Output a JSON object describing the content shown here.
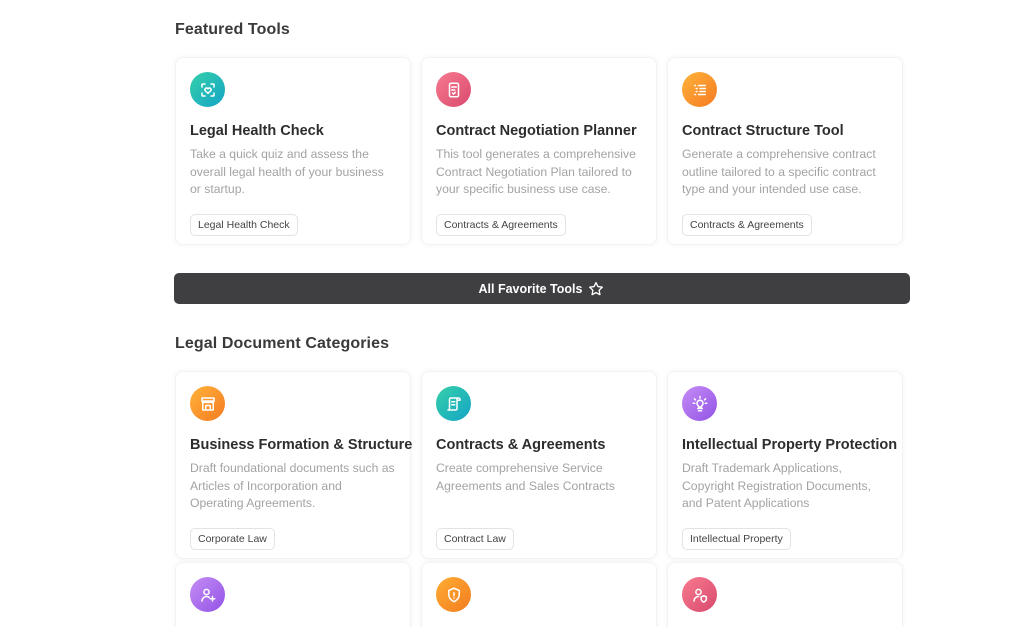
{
  "featured": {
    "title": "Featured Tools",
    "cards": [
      {
        "icon": "heart-check-icon",
        "color": "teal",
        "title": "Legal Health Check",
        "desc": "Take a quick quiz and assess the overall legal health of your business or startup.",
        "tag": "Legal Health Check"
      },
      {
        "icon": "document-check-icon",
        "color": "pink",
        "title": "Contract Negotiation Planner",
        "desc": "This tool generates a comprehensive Contract Negotiation Plan tailored to your specific business use case.",
        "tag": "Contracts & Agreements"
      },
      {
        "icon": "list-icon",
        "color": "orange",
        "title": "Contract Structure Tool",
        "desc": "Generate a comprehensive contract outline tailored to a specific contract type and your intended use case.",
        "tag": "Contracts & Agreements"
      }
    ]
  },
  "favorites_button": {
    "label": "All Favorite Tools",
    "icon": "star-icon"
  },
  "categories": {
    "title": "Legal Document Categories",
    "cards": [
      {
        "icon": "storefront-icon",
        "color": "orange",
        "title": "Business Formation & Structure",
        "desc": "Draft foundational documents such as Articles of Incorporation and Operating Agreements.",
        "tag": "Corporate Law"
      },
      {
        "icon": "scroll-icon",
        "color": "teal",
        "title": "Contracts & Agreements",
        "desc": "Create comprehensive Service Agreements and Sales Contracts",
        "tag": "Contract Law"
      },
      {
        "icon": "lightbulb-icon",
        "color": "purple",
        "title": "Intellectual Property Protection",
        "desc": "Draft Trademark Applications, Copyright Registration Documents, and Patent Applications",
        "tag": "Intellectual Property"
      }
    ],
    "more_cards": [
      {
        "icon": "user-plus-icon",
        "color": "purple"
      },
      {
        "icon": "shield-icon",
        "color": "amber"
      },
      {
        "icon": "user-shield-icon",
        "color": "pink"
      }
    ]
  }
}
